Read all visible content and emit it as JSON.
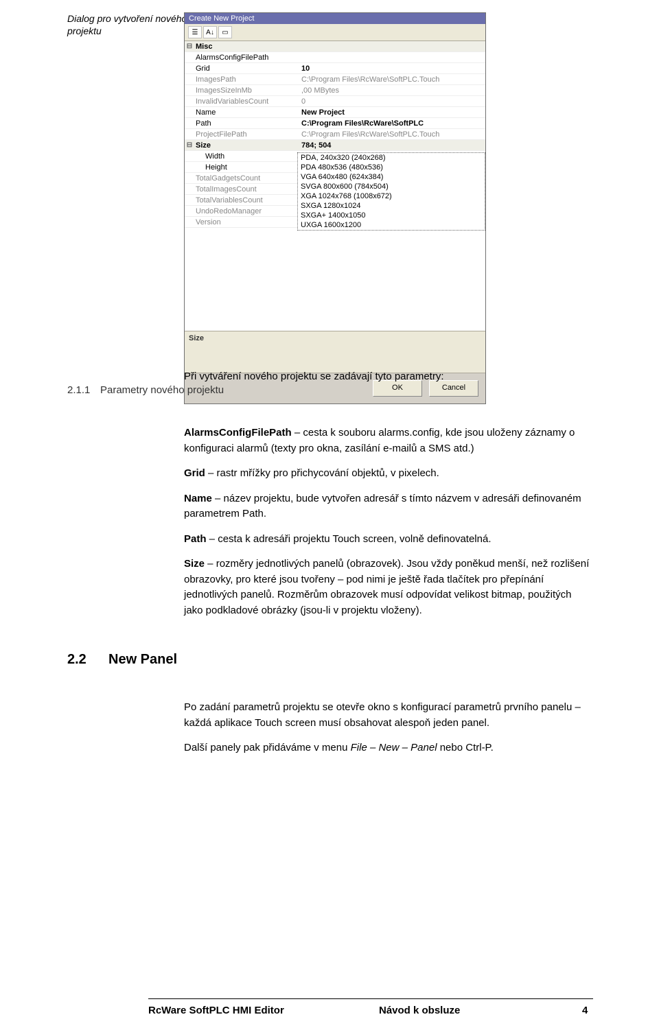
{
  "caption": "Dialog pro vytvoření nového projektu",
  "dialog": {
    "title": "Create New Project",
    "toolbar_icons": [
      "cat-icon",
      "az-icon",
      "page-icon"
    ],
    "cat_misc": "Misc",
    "rows": {
      "alarms_k": "AlarmsConfigFilePath",
      "alarms_v": "",
      "grid_k": "Grid",
      "grid_v": "10",
      "images_k": "ImagesPath",
      "images_v": "C:\\Program Files\\RcWare\\SoftPLC.Touch",
      "imgsize_k": "ImagesSizeInMb",
      "imgsize_v": ",00 MBytes",
      "inv_k": "InvalidVariablesCount",
      "inv_v": "0",
      "name_k": "Name",
      "name_v": "New Project",
      "path_k": "Path",
      "path_v": "C:\\Program Files\\RcWare\\SoftPLC",
      "projpath_k": "ProjectFilePath",
      "projpath_v": "C:\\Program Files\\RcWare\\SoftPLC.Touch"
    },
    "cat_size": "Size",
    "size_v": "784; 504",
    "width_k": "Width",
    "height_k": "Height",
    "dropdown": [
      "PDA, 240x320 (240x268)",
      "PDA 480x536 (480x536)",
      "VGA 640x480 (624x384)",
      "SVGA 800x600 (784x504)",
      "XGA 1024x768 (1008x672)",
      "SXGA 1280x1024",
      "SXGA+ 1400x1050",
      "UXGA 1600x1200"
    ],
    "tgc_k": "TotalGadgetsCount",
    "tic_k": "TotalImagesCount",
    "tvc_k": "TotalVariablesCount",
    "undo_k": "UndoRedoManager",
    "ver_k": "Version",
    "desc_label": "Size",
    "ok": "OK",
    "cancel": "Cancel"
  },
  "intro": "Při vytváření nového projektu se zadávají tyto parametry:",
  "sec211": {
    "num": "2.1.1",
    "title": "Parametry nového projektu"
  },
  "params": {
    "p1a": "AlarmsConfigFilePath",
    "p1b": " – cesta k souboru alarms.config, kde jsou uloženy záznamy o konfiguraci alarmů (texty pro okna, zasílání e-mailů a SMS atd.)",
    "p2a": "Grid",
    "p2b": " – rastr mřížky pro přichycování objektů, v pixelech.",
    "p3a": "Name",
    "p3b": " – název projektu, bude vytvořen adresář s tímto názvem v adresáři definovaném parametrem Path.",
    "p4a": "Path",
    "p4b": " – cesta k adresáři projektu Touch screen, volně definovatelná.",
    "p5a": "Size",
    "p5b": " – rozměry jednotlivých panelů (obrazovek). Jsou vždy poněkud menší, než rozlišení obrazovky, pro které jsou tvořeny – pod nimi je ještě řada tlačítek pro přepínání jednotlivých panelů. Rozměrům obrazovek musí odpovídat velikost bitmap, použitých jako podkladové obrázky (jsou-li v projektu vloženy)."
  },
  "sec22": {
    "num": "2.2",
    "title": "New Panel"
  },
  "after22": {
    "p1": "Po zadání parametrů projektu se otevře okno s konfigurací parametrů prvního panelu – každá aplikace Touch screen musí obsahovat alespoň jeden panel.",
    "p2a": "Další panely pak přidáváme v menu ",
    "p2b": "File – New – Panel",
    "p2c": " nebo Ctrl-P."
  },
  "footer": {
    "left": "RcWare SoftPLC HMI Editor",
    "mid": "Návod k obsluze",
    "right": "4"
  }
}
